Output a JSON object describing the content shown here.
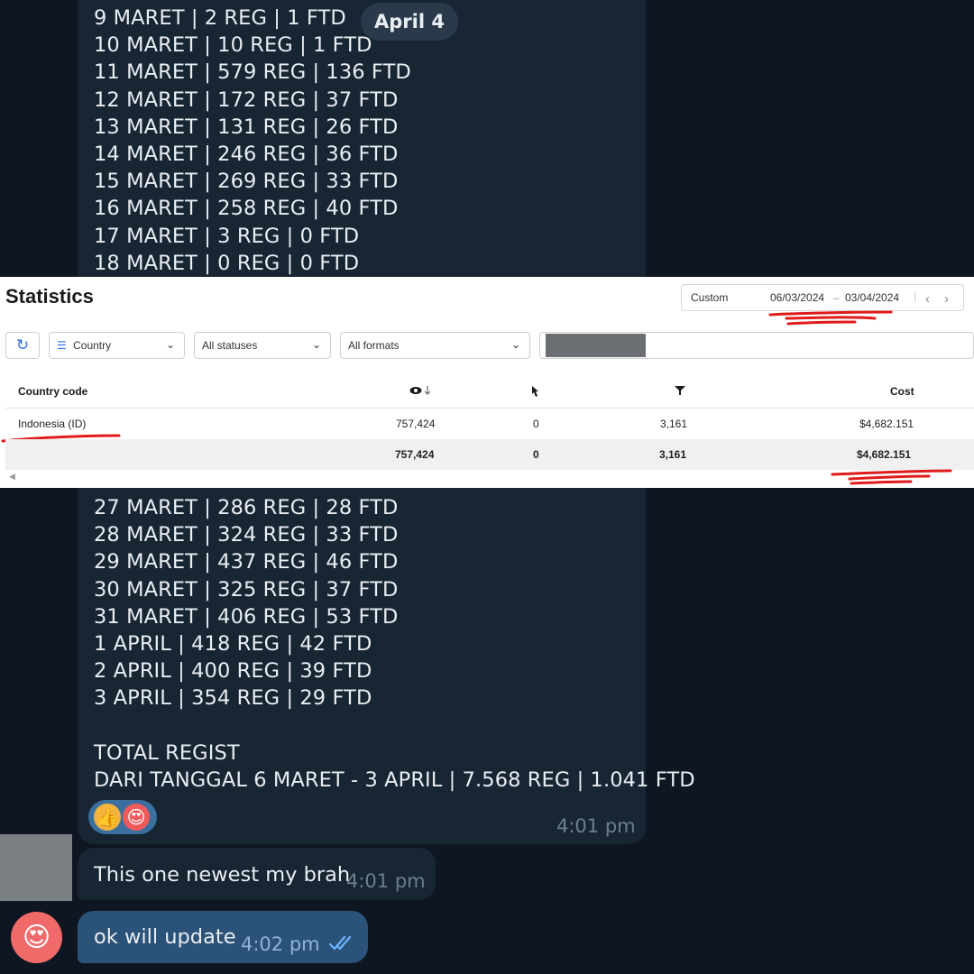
{
  "chat": {
    "date_pill": "April 4",
    "top_lines": [
      "9 MARET | 2 REG | 1 FTD",
      "10 MARET | 10 REG | 1 FTD",
      "11 MARET | 579 REG | 136 FTD",
      "12 MARET | 172 REG | 37 FTD",
      "13 MARET | 131 REG | 26 FTD",
      "14 MARET | 246 REG | 36 FTD",
      "15 MARET | 269 REG | 33 FTD",
      "16 MARET | 258 REG | 40 FTD",
      "17 MARET | 3 REG | 0 FTD",
      "18 MARET | 0 REG | 0 FTD"
    ],
    "bottom_lines": [
      "27 MARET | 286 REG | 28 FTD",
      "28 MARET | 324 REG | 33 FTD",
      "29 MARET | 437 REG | 46 FTD",
      "30 MARET | 325 REG | 37 FTD",
      "31 MARET | 406 REG | 53 FTD",
      "1 APRIL | 418 REG | 42 FTD",
      "2 APRIL | 400 REG | 39 FTD",
      "3 APRIL | 354 REG | 29 FTD"
    ],
    "total_title": "TOTAL REGIST",
    "total_line": "DARI TANGGAL 6 MARET - 3 APRIL | 7.568 REG | 1.041 FTD",
    "reactions": {
      "thumbs": "👍",
      "heart_eyes": "😍"
    },
    "report_time": "4:01 pm",
    "incoming": {
      "text": "This one newest my brah",
      "time": "4:01 pm"
    },
    "outgoing": {
      "text": "ok will update",
      "time": "4:02 pm",
      "status_icon": "double-check"
    },
    "my_avatar_emoji": "😍"
  },
  "stats": {
    "title": "Statistics",
    "range_mode": "Custom",
    "date_from": "06/03/2024",
    "date_sep": "–",
    "date_to": "03/04/2024",
    "group_by": "Country",
    "status_filter": "All statuses",
    "format_filter": "All formats",
    "columns": {
      "country": "Country code",
      "impressions_icon": "eye-icon",
      "clicks_icon": "cursor-icon",
      "conversions_icon": "funnel-icon",
      "cost": "Cost"
    },
    "row": {
      "country": "Indonesia (ID)",
      "impressions": "757,424",
      "clicks": "0",
      "conversions": "3,161",
      "cost": "$4,682.151"
    },
    "total": {
      "impressions": "757,424",
      "clicks": "0",
      "conversions": "3,161",
      "cost": "$4,682.151"
    },
    "accent_color": "#2f6fe0",
    "marker_color": "#e01b1b"
  }
}
